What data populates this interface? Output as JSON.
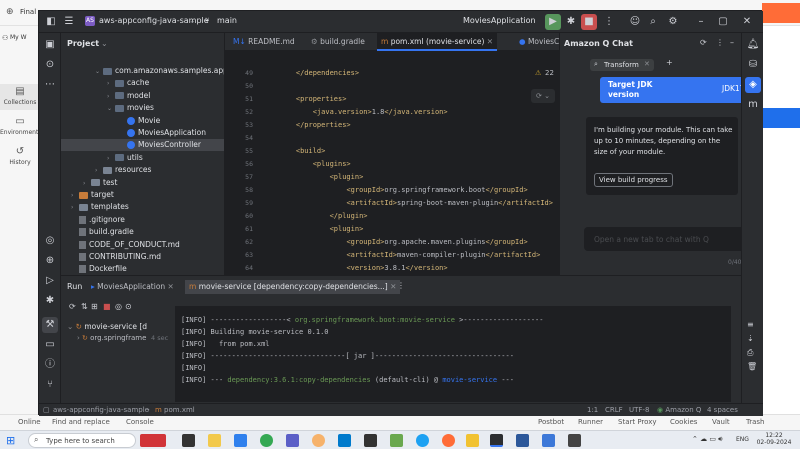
{
  "background_app": {
    "tab_title": "Final",
    "workspace": "My W",
    "sidebar": [
      {
        "label": "Collections",
        "icon": "collections-icon"
      },
      {
        "label": "Environments",
        "icon": "environments-icon"
      },
      {
        "label": "History",
        "icon": "history-icon"
      }
    ],
    "bottom_items": [
      "Online",
      "Find and replace",
      "Console",
      "Postbot",
      "Runner",
      "Start Proxy",
      "Cookies",
      "Vault",
      "Trash"
    ]
  },
  "ide": {
    "project_name": "aws-appconfig-java-sample",
    "branch": "main",
    "run_config": "MoviesApplication",
    "project_panel_title": "Project",
    "tree": [
      {
        "label": "com.amazonaws.samples.app",
        "kind": "pkg",
        "depth": 3,
        "arrow": "down"
      },
      {
        "label": "cache",
        "kind": "pkg",
        "depth": 4,
        "arrow": "right"
      },
      {
        "label": "model",
        "kind": "pkg",
        "depth": 4,
        "arrow": "right"
      },
      {
        "label": "movies",
        "kind": "pkg",
        "depth": 4,
        "arrow": "down"
      },
      {
        "label": "Movie",
        "kind": "class",
        "depth": 5,
        "arrow": ""
      },
      {
        "label": "MoviesApplication",
        "kind": "class",
        "depth": 5,
        "arrow": ""
      },
      {
        "label": "MoviesController",
        "kind": "class",
        "depth": 5,
        "arrow": "",
        "selected": true
      },
      {
        "label": "utils",
        "kind": "pkg",
        "depth": 4,
        "arrow": "right"
      },
      {
        "label": "resources",
        "kind": "folder",
        "depth": 3,
        "arrow": "right"
      },
      {
        "label": "test",
        "kind": "folder",
        "depth": 2,
        "arrow": "right"
      },
      {
        "label": "target",
        "kind": "orange",
        "depth": 1,
        "arrow": "right"
      },
      {
        "label": "templates",
        "kind": "folder",
        "depth": 1,
        "arrow": "right"
      },
      {
        "label": ".gitignore",
        "kind": "file",
        "depth": 1,
        "arrow": ""
      },
      {
        "label": "build.gradle",
        "kind": "file",
        "depth": 1,
        "arrow": ""
      },
      {
        "label": "CODE_OF_CONDUCT.md",
        "kind": "file",
        "depth": 1,
        "arrow": ""
      },
      {
        "label": "CONTRIBUTING.md",
        "kind": "file",
        "depth": 1,
        "arrow": ""
      },
      {
        "label": "Dockerfile",
        "kind": "file",
        "depth": 1,
        "arrow": ""
      }
    ],
    "editor_tabs": [
      "README.md",
      "build.gradle",
      "pom.xml (movie-service)",
      "MoviesC"
    ],
    "warnings_count": "22",
    "code_lines": [
      {
        "n": "49",
        "text": "    </dependencies>"
      },
      {
        "n": "50",
        "text": ""
      },
      {
        "n": "51",
        "text": "    <properties>"
      },
      {
        "n": "52",
        "text": "        <java.version>1.8</java.version>"
      },
      {
        "n": "53",
        "text": "    </properties>"
      },
      {
        "n": "54",
        "text": ""
      },
      {
        "n": "55",
        "text": "    <build>"
      },
      {
        "n": "56",
        "text": "        <plugins>"
      },
      {
        "n": "57",
        "text": "            <plugin>"
      },
      {
        "n": "58",
        "text": "                <groupId>org.springframework.boot</groupId>"
      },
      {
        "n": "59",
        "text": "                <artifactId>spring-boot-maven-plugin</artifactId>"
      },
      {
        "n": "60",
        "text": "            </plugin>"
      },
      {
        "n": "61",
        "text": "            <plugin>"
      },
      {
        "n": "62",
        "text": "                <groupId>org.apache.maven.plugins</groupId>"
      },
      {
        "n": "63",
        "text": "                <artifactId>maven-compiler-plugin</artifactId>"
      },
      {
        "n": "64",
        "text": "                <version>3.8.1</version>"
      }
    ],
    "q_chat": {
      "title": "Amazon Q Chat",
      "tab_label": "Transform",
      "banner_title": "Target JDK version",
      "banner_value": "JDK17",
      "message": "I'm building your module. This can take up to 10 minutes, depending on the size of your module.",
      "button": "View build progress",
      "input_placeholder": "Open a new tab to chat with Q",
      "char_count": "0/4000"
    },
    "run": {
      "label": "Run",
      "tab1": "MoviesApplication",
      "tab2": "movie-service [dependency:copy-dependencies...]",
      "tree_root": "movie-service [d",
      "tree_child": "org.springframe",
      "tree_child_time": "4 sec",
      "console_lines": [
        {
          "prefix": "[INFO]",
          "text": " ------------------< org.springframework.boot:movie-service >-------------------",
          "style": "green"
        },
        {
          "prefix": "[INFO]",
          "text": " Building movie-service 0.1.0",
          "style": ""
        },
        {
          "prefix": "[INFO]",
          "text": "   from pom.xml",
          "style": ""
        },
        {
          "prefix": "[INFO]",
          "text": " --------------------------------[ jar ]---------------------------------",
          "style": ""
        },
        {
          "prefix": "[INFO]",
          "text": "",
          "style": ""
        },
        {
          "prefix": "[INFO]",
          "text": " --- dependency:3.6.1:copy-dependencies (default-cli) @ movie-service ---",
          "style": "mix"
        }
      ]
    },
    "status": {
      "breadcrumb1": "aws-appconfig-java-sample",
      "breadcrumb2": "pom.xml",
      "position": "1:1",
      "line_ending": "CRLF",
      "encoding": "UTF-8",
      "amazon_q": "Amazon Q",
      "indent": "4 spaces"
    }
  },
  "taskbar": {
    "search_placeholder": "Type here to search",
    "lang": "ENG",
    "time": "12:22",
    "date": "02-09-2024"
  }
}
